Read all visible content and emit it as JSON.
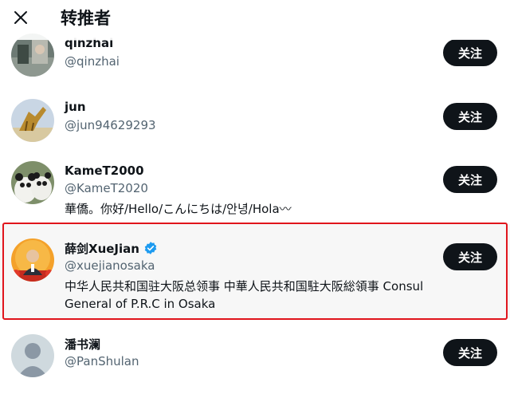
{
  "header": {
    "title": "转推者",
    "close_icon": "close-icon"
  },
  "theme": {
    "text": "#0f1419",
    "secondary_text": "#536471",
    "button_bg": "#0f1419",
    "verified_blue": "#1d9bf0",
    "highlight_border": "#e0151c"
  },
  "users": [
    {
      "name": "qinzhai",
      "handle": "@qinzhai",
      "bio": "",
      "follow_label": "关注",
      "verified": false
    },
    {
      "name": "jun",
      "handle": "@jun94629293",
      "bio": "",
      "follow_label": "关注",
      "verified": false
    },
    {
      "name": "KameT2000",
      "handle": "@KameT2020",
      "bio": "華僑。你好/Hello/こんにちは/안녕/Hola〰",
      "follow_label": "关注",
      "verified": false
    },
    {
      "name": "薛剑XueJian",
      "handle": "@xuejianosaka",
      "bio": "中华人民共和国驻大阪总领事 中華人民共和国駐大阪総領事 Consul General of P.R.C in Osaka",
      "follow_label": "关注",
      "verified": true,
      "verified_icon": "verified-badge-icon"
    },
    {
      "name": "潘书澜",
      "handle": "@PanShulan",
      "bio": "",
      "follow_label": "关注",
      "verified": false
    }
  ]
}
